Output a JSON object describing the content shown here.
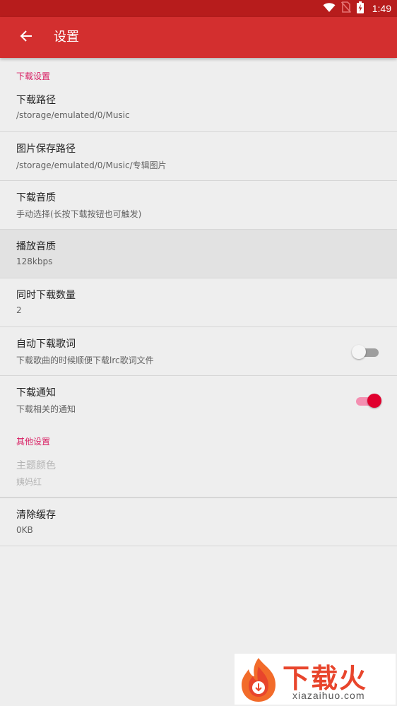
{
  "status_bar": {
    "time": "1:49",
    "icons": [
      "wifi-icon",
      "no-sim-icon",
      "battery-charging-icon"
    ]
  },
  "app_bar": {
    "title": "设置",
    "back_icon": "arrow-left-icon"
  },
  "sections": {
    "download": {
      "header": "下载设置",
      "items": {
        "path": {
          "title": "下载路径",
          "summary": "/storage/emulated/0/Music"
        },
        "image_path": {
          "title": "图片保存路径",
          "summary": "/storage/emulated/0/Music/专辑图片"
        },
        "download_quality": {
          "title": "下载音质",
          "summary": "手动选择(长按下载按钮也可触发)"
        },
        "play_quality": {
          "title": "播放音质",
          "summary": "128kbps"
        },
        "concurrent": {
          "title": "同时下载数量",
          "summary": "2"
        },
        "auto_lyrics": {
          "title": "自动下载歌词",
          "summary": "下载歌曲的时候顺便下载lrc歌词文件",
          "enabled": false
        },
        "notify": {
          "title": "下载通知",
          "summary": "下载相关的通知",
          "enabled": true
        }
      }
    },
    "other": {
      "header": "其他设置",
      "items": {
        "theme": {
          "title": "主题颜色",
          "summary": "姨妈红",
          "disabled": true
        },
        "cache": {
          "title": "清除缓存",
          "summary": "0KB"
        }
      }
    }
  },
  "watermark": {
    "logo_text": "下载火",
    "url": "xiazaihuo.com"
  },
  "colors": {
    "status_bar": "#b71c1c",
    "app_bar": "#d32f2f",
    "accent": "#e0002e",
    "section_header": "#d81b60",
    "background": "#eeeeee"
  }
}
